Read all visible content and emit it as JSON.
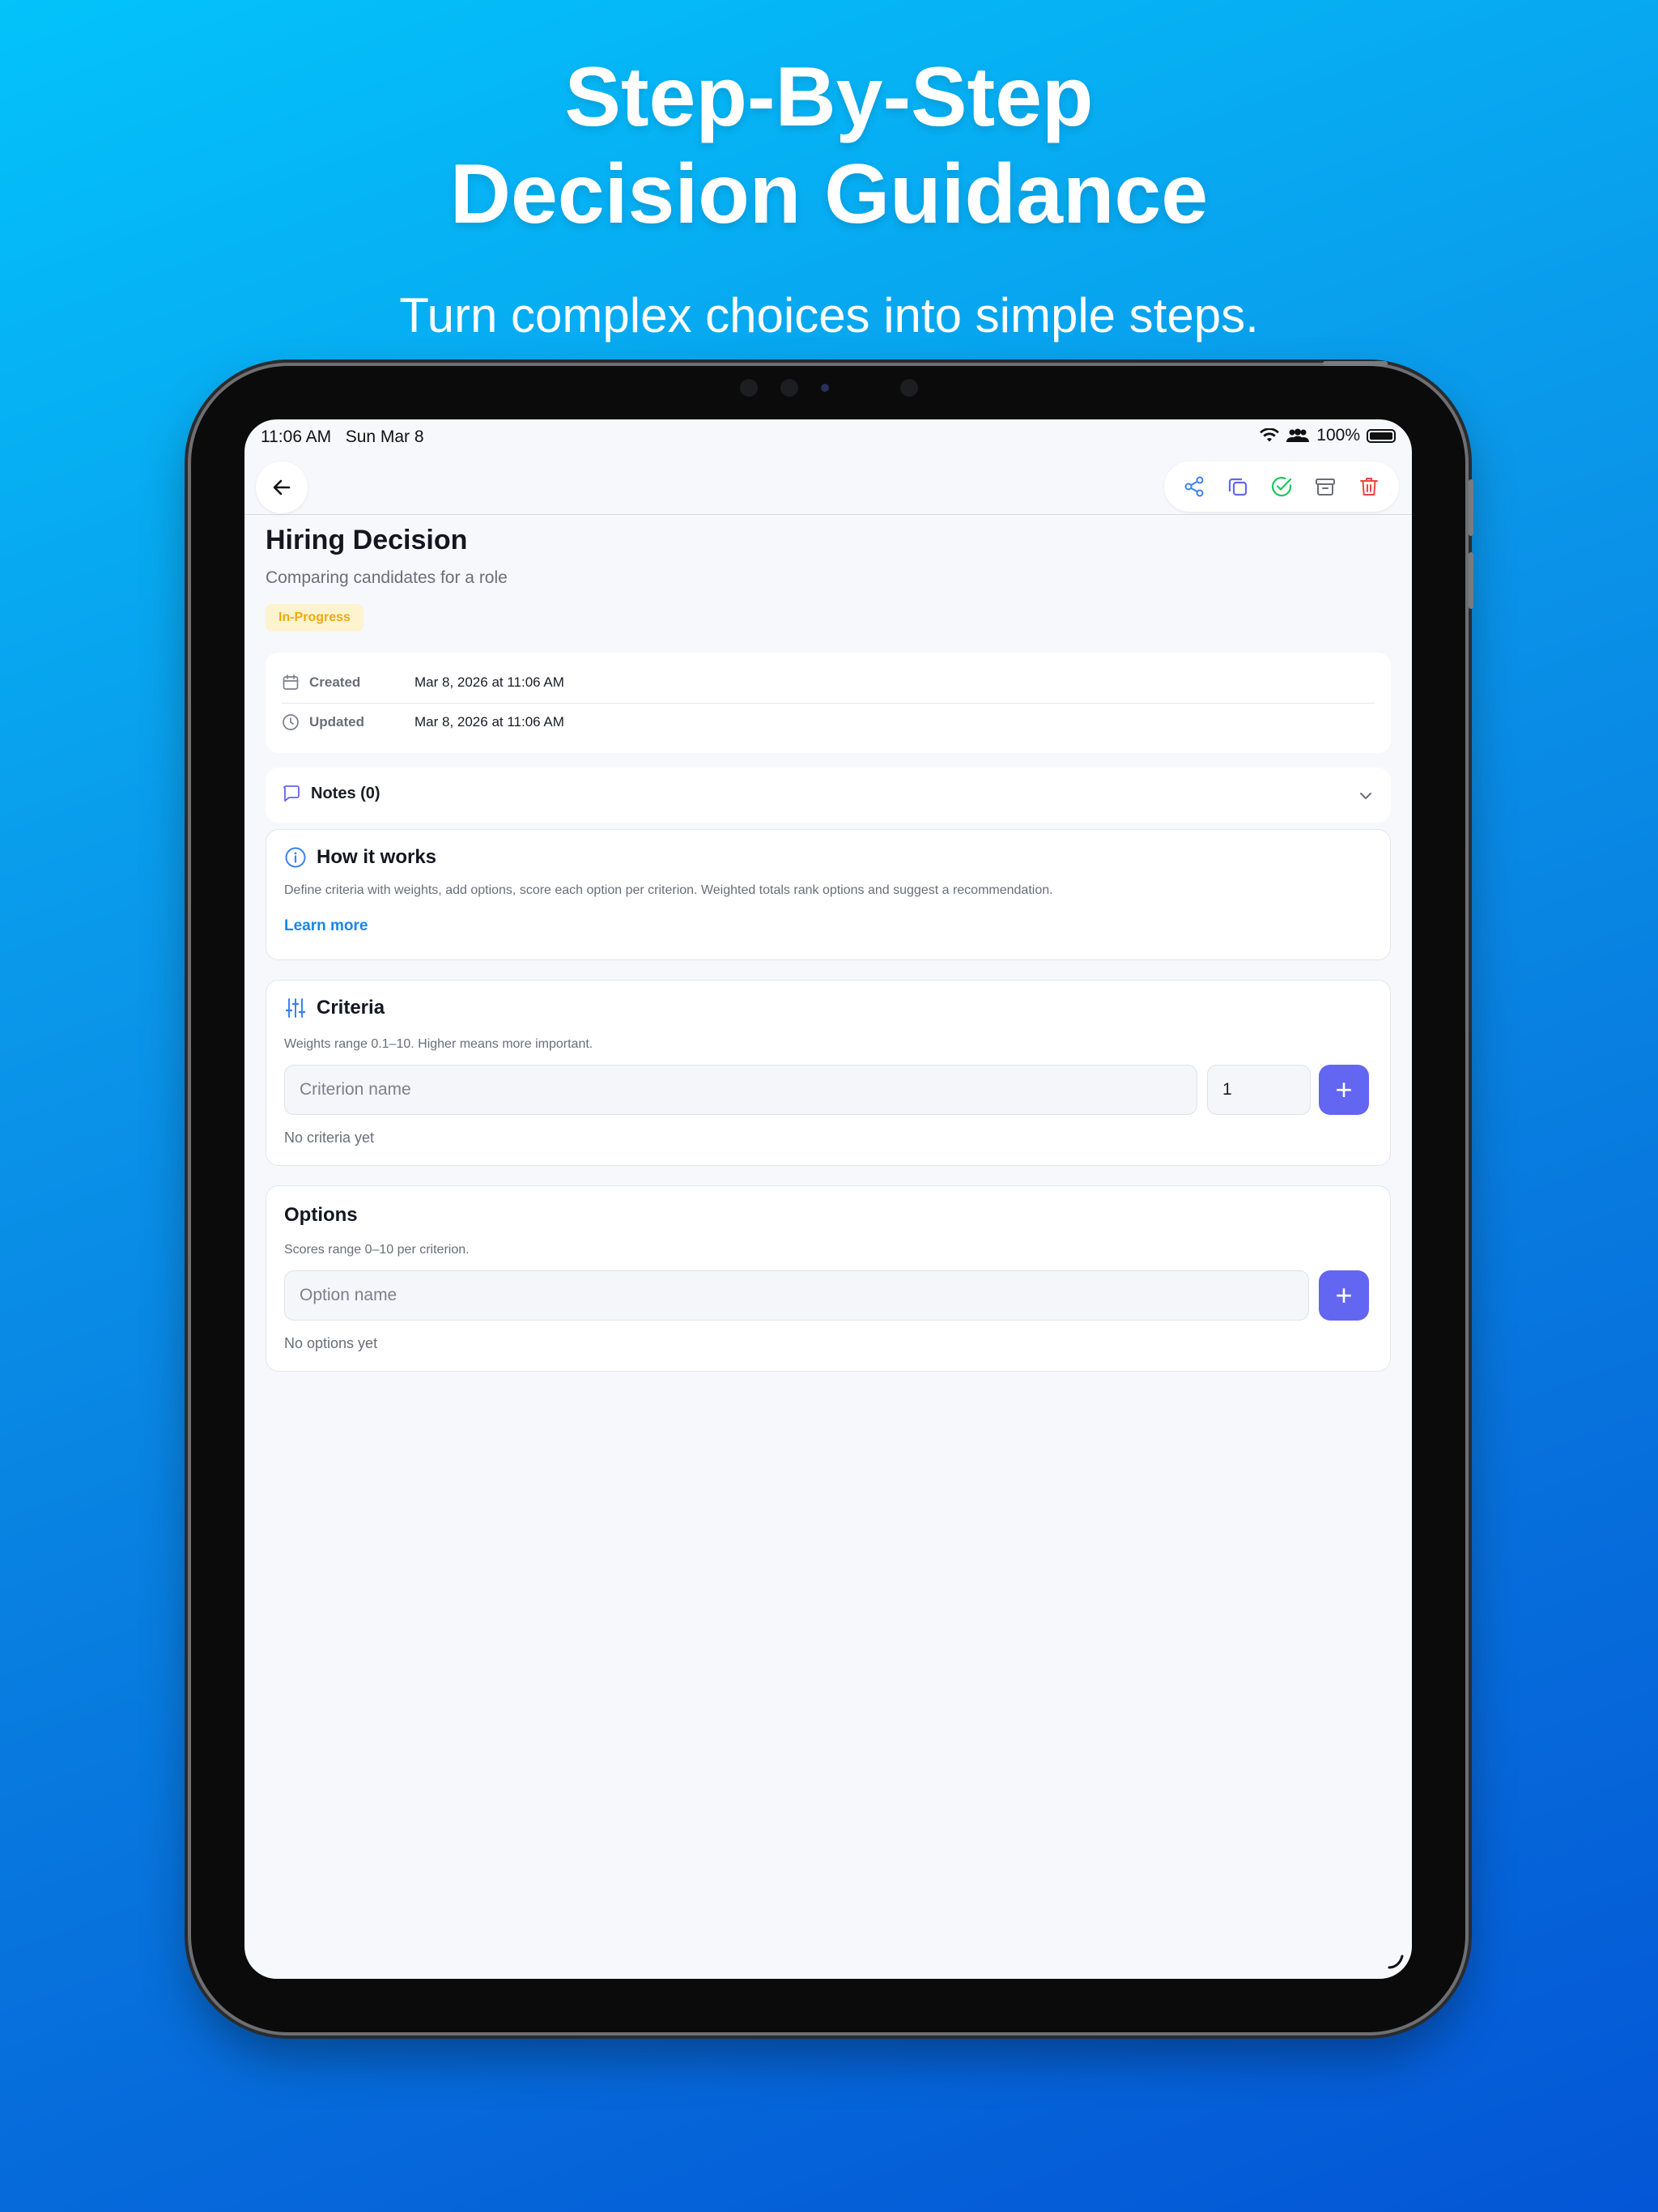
{
  "promo": {
    "headline_line1": "Step-By-Step",
    "headline_line2": "Decision Guidance",
    "subheadline": "Turn complex choices into simple steps."
  },
  "status_bar": {
    "time": "11:06 AM",
    "date": "Sun Mar 8",
    "battery": "100%"
  },
  "toolbar": {
    "icons": [
      "back-arrow-icon",
      "share-icon",
      "duplicate-icon",
      "check-circle-icon",
      "archive-icon",
      "trash-icon"
    ],
    "colors": {
      "share": "#3b82f6",
      "duplicate": "#6366f1",
      "check": "#22c55e",
      "archive": "#6b6e78",
      "trash": "#ef4444"
    }
  },
  "decision": {
    "title": "Hiring Decision",
    "subtitle": "Comparing candidates for a role",
    "status": "In-Progress"
  },
  "meta": {
    "created_label": "Created",
    "created_value": "Mar 8, 2026 at 11:06 AM",
    "updated_label": "Updated",
    "updated_value": "Mar 8, 2026 at 11:06 AM"
  },
  "notes": {
    "label": "Notes (0)"
  },
  "how_it_works": {
    "title": "How it works",
    "body": "Define criteria with weights, add options, score each option per criterion. Weighted totals rank options and suggest a recommendation.",
    "link": "Learn more"
  },
  "criteria": {
    "title": "Criteria",
    "help": "Weights range 0.1–10. Higher means more important.",
    "name_placeholder": "Criterion name",
    "weight_value": "1",
    "add_label": "+",
    "empty": "No criteria yet"
  },
  "options": {
    "title": "Options",
    "help": "Scores range 0–10 per criterion.",
    "name_placeholder": "Option name",
    "add_label": "+",
    "empty": "No options yet"
  },
  "colors": {
    "accent": "#6366f1",
    "link": "#1a86e8",
    "badge_bg": "#fdf3cf",
    "badge_text": "#f0a90c"
  }
}
